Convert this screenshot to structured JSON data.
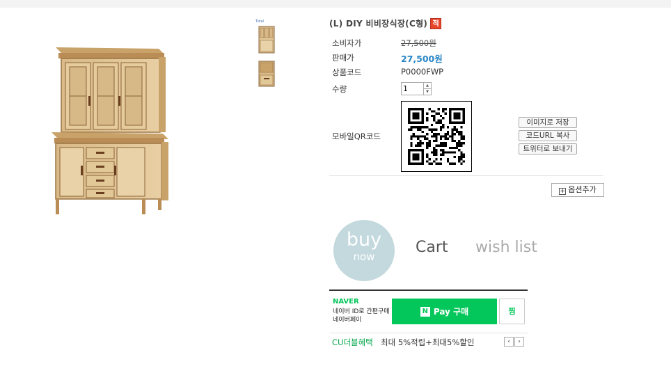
{
  "product": {
    "title": "(L) DIY 비비장식장(C형)",
    "badge": "적",
    "thumb_tag": "Tidal"
  },
  "fields": {
    "consumer_price_label": "소비자가",
    "consumer_price": "27,500원",
    "sale_price_label": "판매가",
    "sale_price": "27,500원",
    "code_label": "상품코드",
    "code": "P0000FWP",
    "qty_label": "수량",
    "qty_value": "1",
    "qr_label": "모바일QR코드"
  },
  "share": {
    "save_image": "이미지로 저장",
    "copy_url": "코드URL 복사",
    "twitter": "트위터로 보내기"
  },
  "options": {
    "add_label": "옵션추가",
    "add_icon": "plus-box-icon"
  },
  "actions": {
    "buy_top": "buy",
    "buy_bottom": "now",
    "cart": "Cart",
    "wish": "wish list"
  },
  "naverpay": {
    "brand": "NAVER",
    "sub1": "네이버 ID로 간편구매",
    "sub2": "네이버페이",
    "n_icon": "N",
    "pay_label": "Pay 구매",
    "jjim": "찜",
    "cu_label": "CU더블혜택",
    "cu_text": "최대 5%적립+최대5%할인",
    "prev": "‹",
    "next": "›"
  },
  "colors": {
    "price": "#2a86c5",
    "buy_circle": "#c3d9de",
    "naver_green": "#03c75a",
    "badge_red": "#e8452c"
  }
}
